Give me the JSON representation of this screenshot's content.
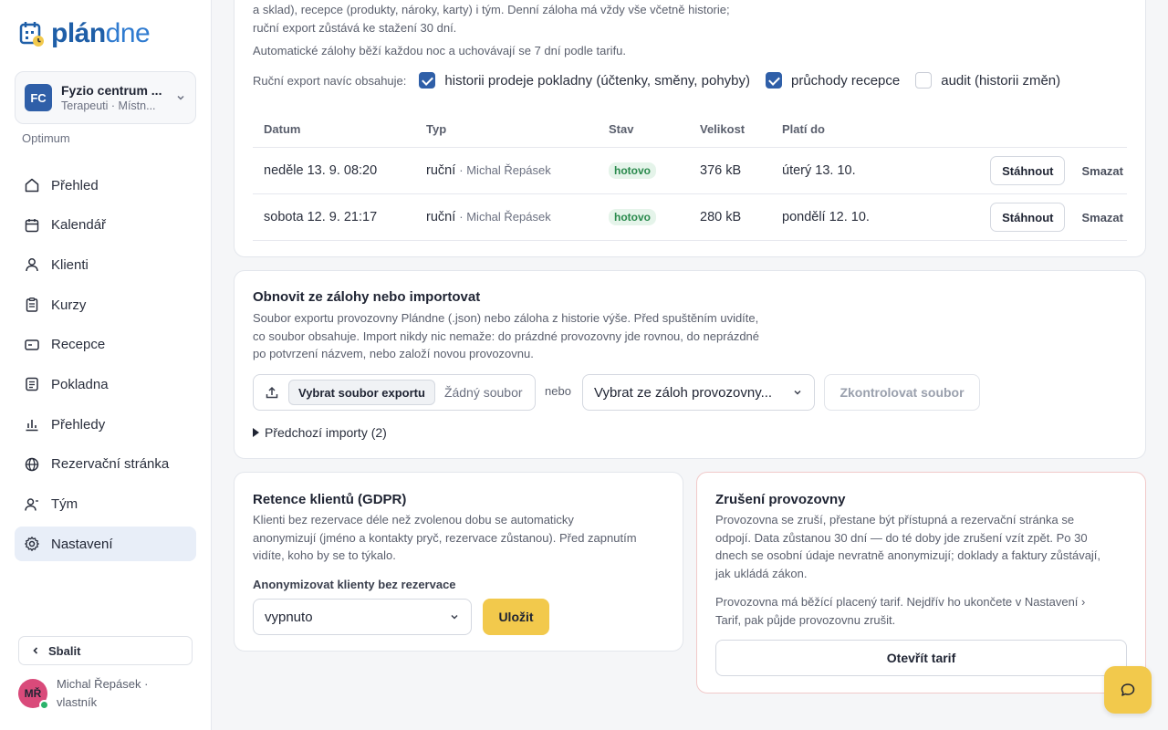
{
  "brand": {
    "logo_bold": "plán",
    "logo_light": "dne"
  },
  "org": {
    "initials": "FC",
    "name": "Fyzio centrum ...",
    "subtitle": "Terapeuti · Místn..."
  },
  "plan": "Optimum",
  "nav": [
    {
      "label": "Přehled",
      "icon": "home-icon",
      "active": false
    },
    {
      "label": "Kalendář",
      "icon": "calendar-icon",
      "active": false
    },
    {
      "label": "Klienti",
      "icon": "user-icon",
      "active": false
    },
    {
      "label": "Kurzy",
      "icon": "clipboard-icon",
      "active": false
    },
    {
      "label": "Recepce",
      "icon": "card-icon",
      "active": false
    },
    {
      "label": "Pokladna",
      "icon": "receipt-icon",
      "active": false
    },
    {
      "label": "Přehledy",
      "icon": "bar-chart-icon",
      "active": false
    },
    {
      "label": "Rezervační stránka",
      "icon": "globe-icon",
      "active": false
    },
    {
      "label": "Tým",
      "icon": "team-icon",
      "active": false
    },
    {
      "label": "Nastavení",
      "icon": "gear-icon",
      "active": true
    }
  ],
  "collapse_label": "Sbalit",
  "user": {
    "initials": "MŘ",
    "name": "Michal Řepásek · vlastník"
  },
  "backup": {
    "desc_line1": "a sklad), recepce (produkty, nároky, karty) i tým. Denní záloha má vždy vše včetně historie;",
    "desc_line2": "ruční export zůstává ke stažení 30 dní.",
    "auto_note": "Automatické zálohy běží každou noc a uchovávají se 7 dní podle tarifu.",
    "export_label": "Ruční export navíc obsahuje:",
    "options": [
      {
        "label": "historii prodeje pokladny (účtenky, směny, pohyby)",
        "checked": true
      },
      {
        "label": "průchody recepce",
        "checked": true
      },
      {
        "label": "audit (historii změn)",
        "checked": false
      }
    ],
    "columns": [
      "Datum",
      "Typ",
      "Stav",
      "Velikost",
      "Platí do"
    ],
    "rows": [
      {
        "date": "neděle 13. 9. 08:20",
        "type": "ruční",
        "by": "· Michal Řepásek",
        "status": "hotovo",
        "size": "376 kB",
        "valid": "úterý 13. 10.",
        "download": "Stáhnout",
        "delete": "Smazat"
      },
      {
        "date": "sobota 12. 9. 21:17",
        "type": "ruční",
        "by": "· Michal Řepásek",
        "status": "hotovo",
        "size": "280 kB",
        "valid": "pondělí 12. 10.",
        "download": "Stáhnout",
        "delete": "Smazat"
      }
    ]
  },
  "restore": {
    "title": "Obnovit ze zálohy nebo importovat",
    "desc_line1": "Soubor exportu provozovny Plándne (.json) nebo záloha z historie výše. Před spuštěním uvidíte,",
    "desc_line2": "co soubor obsahuje. Import nikdy nic nemaže: do prázdné provozovny jde rovnou, do neprázdné",
    "desc_line3": "po potvrzení názvem, nebo založí novou provozovnu.",
    "file_button": "Vybrat soubor exportu",
    "file_none": "Žádný soubor",
    "or": "nebo",
    "backup_select": "Vybrat ze záloh provozovny...",
    "check_button": "Zkontrolovat soubor",
    "prev_imports": "Předchozí importy (2)"
  },
  "gdpr": {
    "title": "Retence klientů (GDPR)",
    "desc_line1": "Klienti bez rezervace déle než zvolenou dobu se automaticky",
    "desc_line2": "anonymizují (jméno a kontakty pryč, rezervace zůstanou). Před zapnutím",
    "desc_line3": "vidíte, koho by se to týkalo.",
    "field_label": "Anonymizovat klienty bez rezervace",
    "select_value": "vypnuto",
    "save": "Uložit"
  },
  "cancel": {
    "title": "Zrušení provozovny",
    "desc_line1": "Provozovna se zruší, přestane být přístupná a rezervační stránka se",
    "desc_line2": "odpojí. Data zůstanou 30 dní — do té doby jde zrušení vzít zpět. Po 30",
    "desc_line3": "dnech se osobní údaje nevratně anonymizují; doklady a faktury zůstávají,",
    "desc_line4": "jak ukládá zákon.",
    "note_line1": "Provozovna má běžící placený tarif. Nejdřív ho ukončete v Nastavení ›",
    "note_line2": "Tarif, pak půjde provozovnu zrušit.",
    "button": "Otevřít tarif"
  },
  "colors": {
    "brand": "#2f5fa8",
    "accent": "#f2c94c",
    "success": "#2a8a4d",
    "danger_border": "#f1c9c9"
  }
}
